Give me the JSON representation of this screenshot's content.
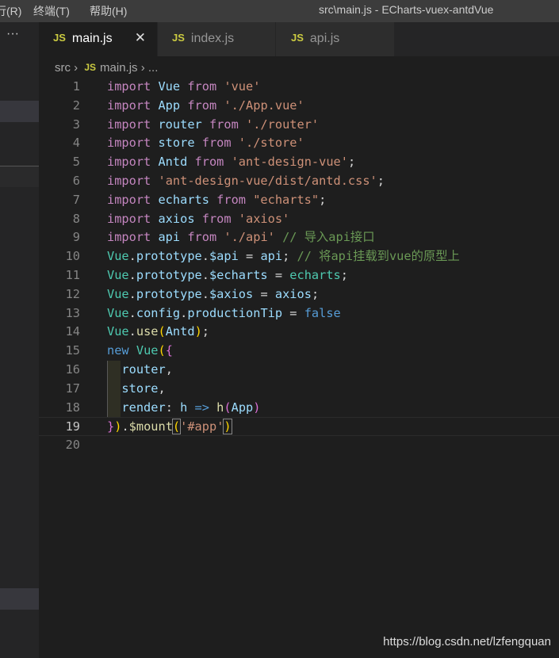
{
  "titlebar": {
    "menus": [
      "行(R)",
      "终端(T)",
      "帮助(H)"
    ],
    "title": "src\\main.js - ECharts-vuex-antdVue"
  },
  "sidebar": {
    "more": "···"
  },
  "tabs": [
    {
      "label": "main.js",
      "icon": "JS",
      "active": true,
      "close": "✕"
    },
    {
      "label": "index.js",
      "icon": "JS"
    },
    {
      "label": "api.js",
      "icon": "JS"
    }
  ],
  "breadcrumb": {
    "folder": "src",
    "sep": "›",
    "icon": "JS",
    "file": "main.js",
    "tail": "..."
  },
  "colors": {
    "keyword": "#c586c0",
    "identifier": "#9cdcfe",
    "string": "#ce9178",
    "class": "#4ec9b0",
    "function": "#dcdcaa",
    "comment": "#6a9955",
    "constant": "#569cd6"
  },
  "editor": {
    "current_line": 19,
    "lines": [
      [
        [
          "import",
          "kw"
        ],
        [
          " Vue ",
          "id"
        ],
        [
          "from",
          "kw"
        ],
        [
          " ",
          "pl"
        ],
        [
          "'vue'",
          "str"
        ]
      ],
      [
        [
          "import",
          "kw"
        ],
        [
          " App ",
          "id"
        ],
        [
          "from",
          "kw"
        ],
        [
          " ",
          "pl"
        ],
        [
          "'./App.vue'",
          "str"
        ]
      ],
      [
        [
          "import",
          "kw"
        ],
        [
          " router ",
          "id"
        ],
        [
          "from",
          "kw"
        ],
        [
          " ",
          "pl"
        ],
        [
          "'./router'",
          "str"
        ]
      ],
      [
        [
          "import",
          "kw"
        ],
        [
          " store ",
          "id"
        ],
        [
          "from",
          "kw"
        ],
        [
          " ",
          "pl"
        ],
        [
          "'./store'",
          "str"
        ]
      ],
      [
        [
          "import",
          "kw"
        ],
        [
          " Antd ",
          "id"
        ],
        [
          "from",
          "kw"
        ],
        [
          " ",
          "pl"
        ],
        [
          "'ant-design-vue'",
          "str"
        ],
        [
          ";",
          "pl"
        ]
      ],
      [
        [
          "import",
          "kw"
        ],
        [
          " ",
          "pl"
        ],
        [
          "'ant-design-vue/dist/antd.css'",
          "str"
        ],
        [
          ";",
          "pl"
        ]
      ],
      [
        [
          "import",
          "kw"
        ],
        [
          " echarts ",
          "id"
        ],
        [
          "from",
          "kw"
        ],
        [
          " ",
          "pl"
        ],
        [
          "\"echarts\"",
          "str"
        ],
        [
          ";",
          "pl"
        ]
      ],
      [
        [
          "import",
          "kw"
        ],
        [
          " axios ",
          "id"
        ],
        [
          "from",
          "kw"
        ],
        [
          " ",
          "pl"
        ],
        [
          "'axios'",
          "str"
        ]
      ],
      [
        [
          "import",
          "kw"
        ],
        [
          " api ",
          "id"
        ],
        [
          "from",
          "kw"
        ],
        [
          " ",
          "pl"
        ],
        [
          "'./api'",
          "str"
        ],
        [
          " // 导入api接口",
          "cm"
        ]
      ],
      [
        [
          "Vue",
          "cls"
        ],
        [
          ".",
          "pl"
        ],
        [
          "prototype",
          "id"
        ],
        [
          ".",
          "pl"
        ],
        [
          "$api",
          "id"
        ],
        [
          " = ",
          "pl"
        ],
        [
          "api",
          "id"
        ],
        [
          ";",
          "pl"
        ],
        [
          " // 将api挂载到vue的原型上",
          "cm"
        ]
      ],
      [
        [
          "Vue",
          "cls"
        ],
        [
          ".",
          "pl"
        ],
        [
          "prototype",
          "id"
        ],
        [
          ".",
          "pl"
        ],
        [
          "$echarts",
          "id"
        ],
        [
          " = ",
          "pl"
        ],
        [
          "echarts",
          "cls"
        ],
        [
          ";",
          "pl"
        ]
      ],
      [
        [
          "Vue",
          "cls"
        ],
        [
          ".",
          "pl"
        ],
        [
          "prototype",
          "id"
        ],
        [
          ".",
          "pl"
        ],
        [
          "$axios",
          "id"
        ],
        [
          " = ",
          "pl"
        ],
        [
          "axios",
          "id"
        ],
        [
          ";",
          "pl"
        ]
      ],
      [
        [
          "Vue",
          "cls"
        ],
        [
          ".",
          "pl"
        ],
        [
          "config",
          "id"
        ],
        [
          ".",
          "pl"
        ],
        [
          "productionTip",
          "id"
        ],
        [
          " = ",
          "pl"
        ],
        [
          "false",
          "bl"
        ]
      ],
      [
        [
          "Vue",
          "cls"
        ],
        [
          ".",
          "pl"
        ],
        [
          "use",
          "fn"
        ],
        [
          "(",
          "br1"
        ],
        [
          "Antd",
          "id"
        ],
        [
          ")",
          "br1"
        ],
        [
          ";",
          "pl"
        ]
      ],
      [
        [
          "new",
          "bl"
        ],
        [
          " ",
          "pl"
        ],
        [
          "Vue",
          "cls"
        ],
        [
          "(",
          "br1"
        ],
        [
          "{",
          "br2"
        ]
      ],
      [
        [
          "  ",
          "pl"
        ],
        [
          "router",
          "id"
        ],
        [
          ",",
          "pl"
        ]
      ],
      [
        [
          "  ",
          "pl"
        ],
        [
          "store",
          "id"
        ],
        [
          ",",
          "pl"
        ]
      ],
      [
        [
          "  ",
          "pl"
        ],
        [
          "render",
          "id"
        ],
        [
          ": ",
          "pl"
        ],
        [
          "h",
          "id"
        ],
        [
          " => ",
          "bl"
        ],
        [
          "h",
          "fn"
        ],
        [
          "(",
          "br2"
        ],
        [
          "App",
          "id"
        ],
        [
          ")",
          "br2"
        ]
      ],
      [
        [
          "}",
          "br2"
        ],
        [
          ")",
          "br1"
        ],
        [
          ".",
          "pl"
        ],
        [
          "$mount",
          "fn"
        ],
        [
          "(",
          "br1 bm"
        ],
        [
          "'#app'",
          "str"
        ],
        [
          ")",
          "br1 bm"
        ]
      ],
      []
    ]
  },
  "watermark": "https://blog.csdn.net/lzfengquan"
}
